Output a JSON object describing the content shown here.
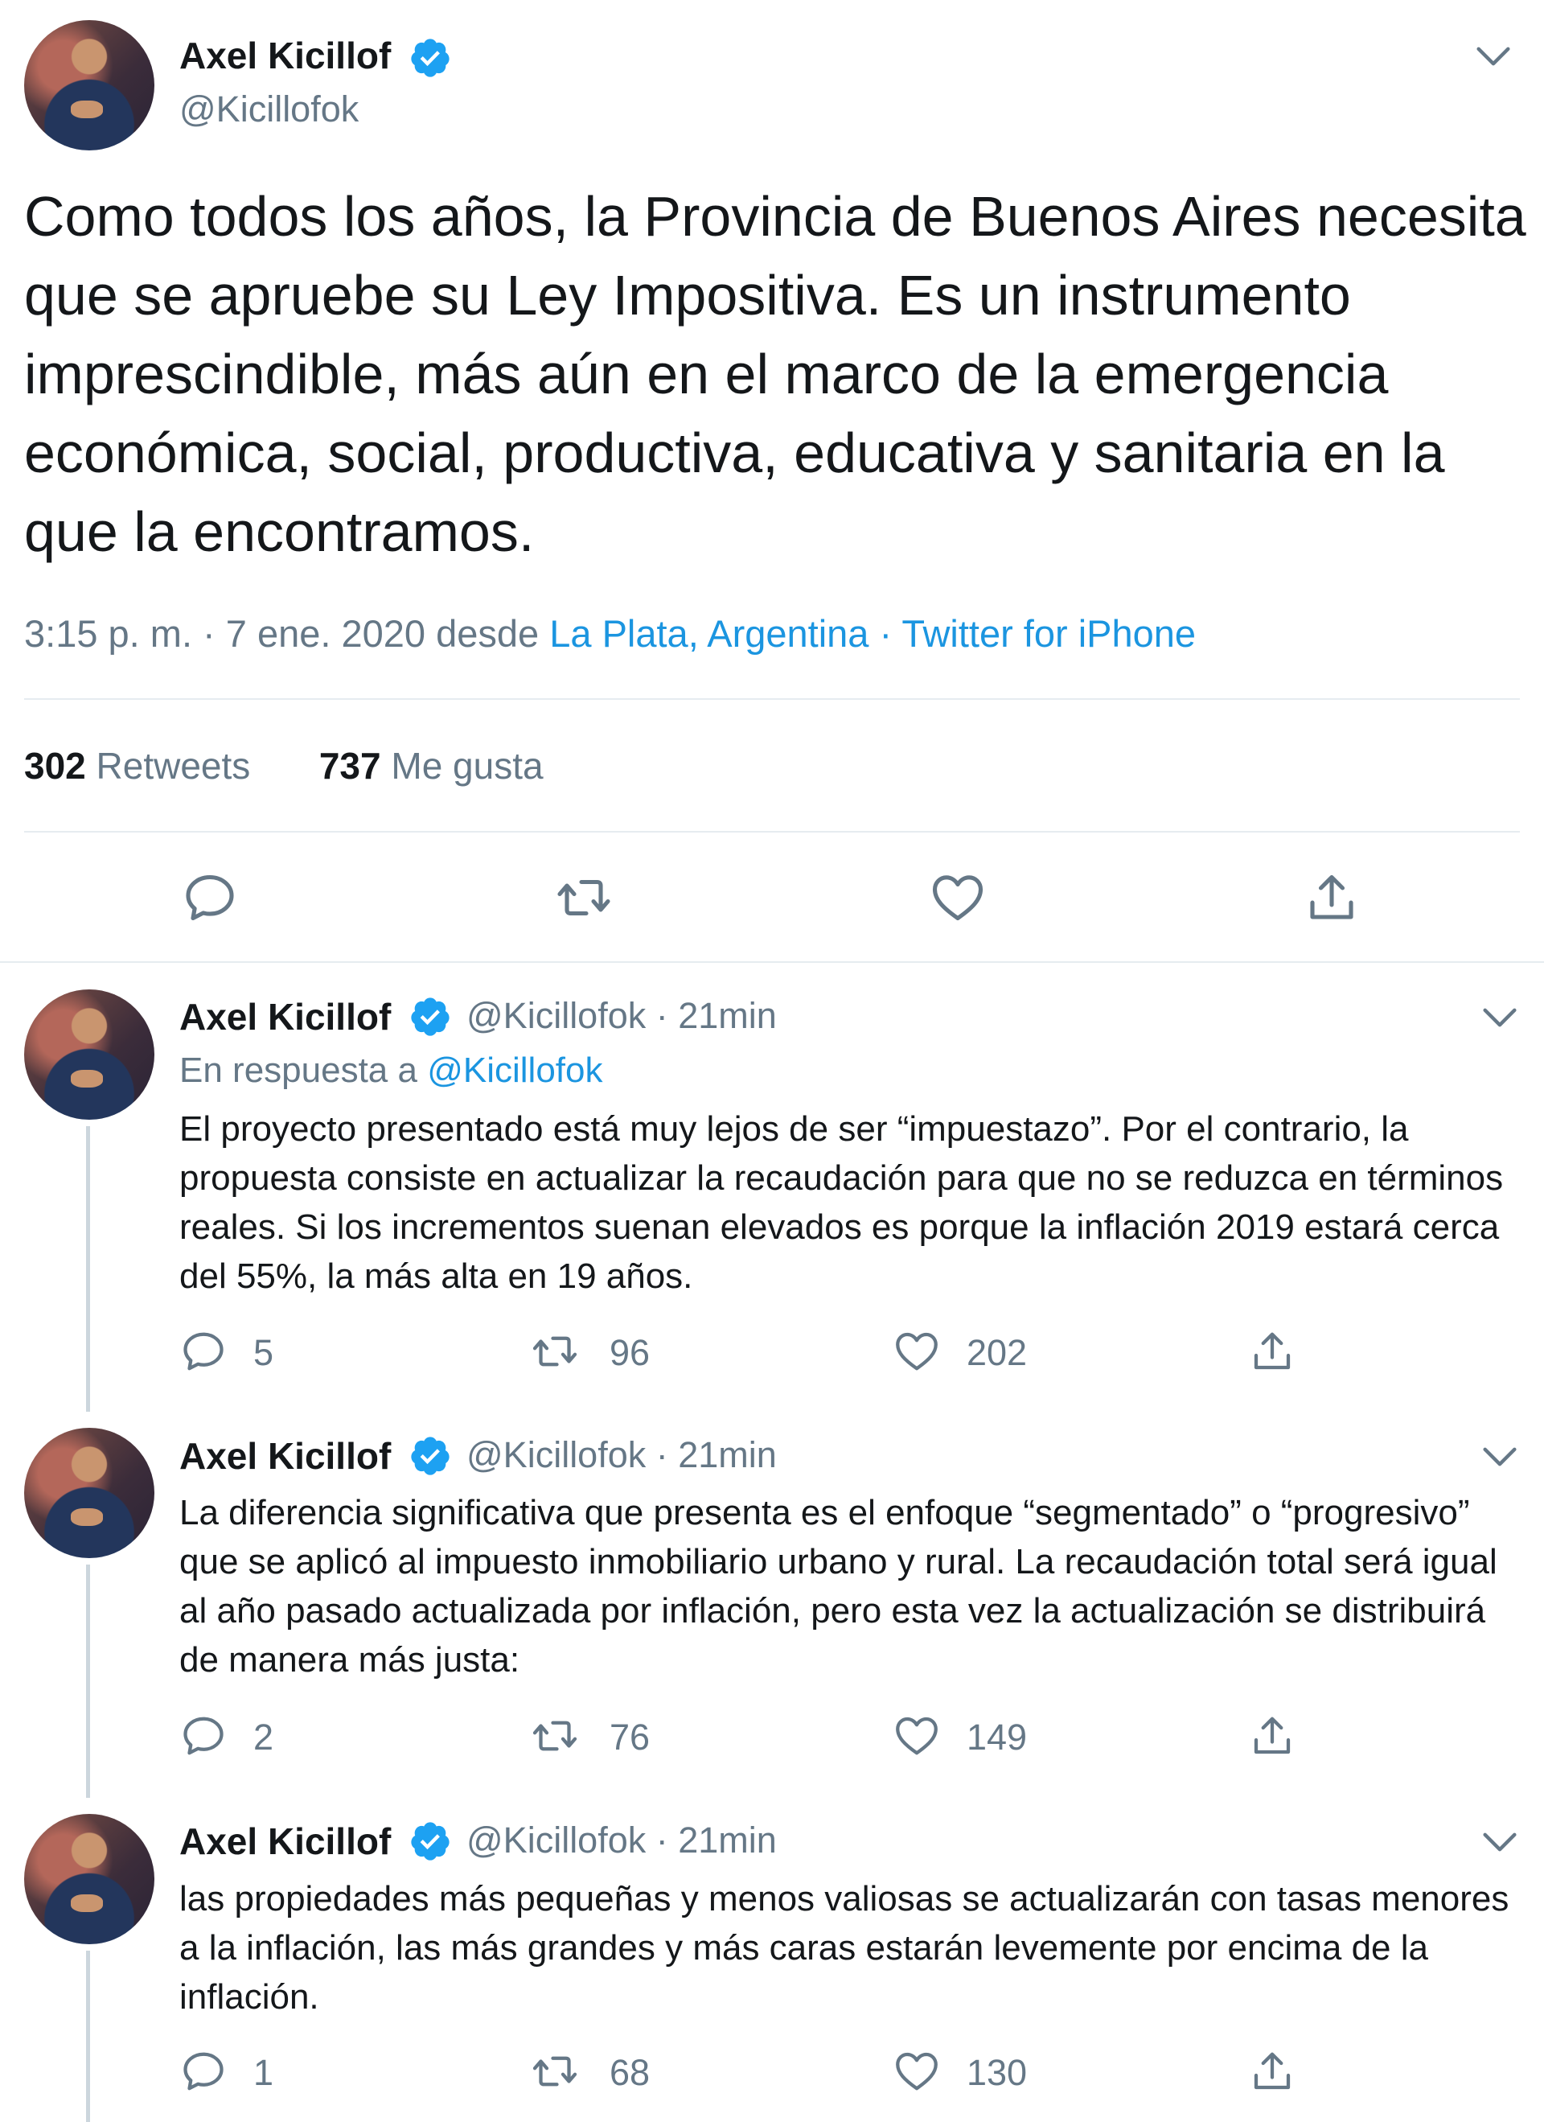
{
  "main_tweet": {
    "name": "Axel Kicillof",
    "handle": "@Kicillofok",
    "text": "Como todos los años, la Provincia de Buenos Aires necesita que se apruebe su Ley Impositiva. Es un instrumento imprescindible, más aún en el marco de la emergencia económica, social, productiva, educativa y sanitaria en la que la encontramos.",
    "time": "3:15 p. m. · 7 ene. 2020 desde ",
    "location": "La Plata, Argentina",
    "source": " · Twitter for iPhone",
    "retweets_count": "302",
    "retweets_label": "Retweets",
    "likes_count": "737",
    "likes_label": "Me gusta"
  },
  "replies": [
    {
      "name": "Axel Kicillof",
      "handle": "@Kicillofok",
      "time": " · 21min",
      "replying_prefix": "En respuesta a ",
      "replying_to": "@Kicillofok",
      "text": "El proyecto presentado está muy lejos de ser “impuestazo”. Por el contrario, la propuesta consiste en actualizar la recaudación para que no se reduzca en términos reales. Si los incrementos suenan elevados es porque la inflación 2019 estará cerca del 55%, la más alta en 19 años.",
      "replies": "5",
      "retweets": "96",
      "likes": "202"
    },
    {
      "name": "Axel Kicillof",
      "handle": "@Kicillofok",
      "time": " · 21min",
      "text": "La diferencia significativa que presenta es el enfoque “segmentado” o “progresivo” que se aplicó al impuesto inmobiliario urbano y rural. La recaudación total será igual al año pasado actualizada por inflación, pero esta vez la actualización se distribuirá de manera más justa:",
      "replies": "2",
      "retweets": "76",
      "likes": "149"
    },
    {
      "name": "Axel Kicillof",
      "handle": "@Kicillofok",
      "time": " · 21min",
      "text": "las propiedades más pequeñas y menos valiosas se actualizarán con tasas menores a la inflación, las más grandes y más caras estarán levemente por encima de la inflación.",
      "replies": "1",
      "retweets": "68",
      "likes": "130"
    }
  ],
  "colors": {
    "link": "#1b95e0",
    "secondary": "#657786",
    "border": "#e6ecf0",
    "verified": "#1da1f2"
  },
  "icons": [
    "verified-badge-icon",
    "chevron-down-icon",
    "reply-icon",
    "retweet-icon",
    "like-icon",
    "share-icon"
  ]
}
